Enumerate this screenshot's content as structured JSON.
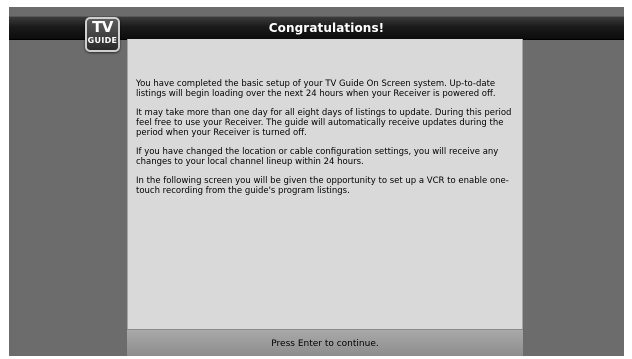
{
  "logo": {
    "line1": "TV",
    "line2": "GUIDE"
  },
  "header": {
    "title": "Congratulations!"
  },
  "content": {
    "paragraphs": [
      "You have completed the basic setup of your TV Guide On Screen system.  Up-to-date listings will begin loading over the next 24 hours when your Receiver is powered off.",
      "It may take more than one day for all eight days of listings to update.  During this period feel free to use your Receiver.  The guide will automatically receive updates during the period when your Receiver is turned off.",
      "If you have changed the location or cable configuration settings, you will receive any changes to your local channel lineup within 24 hours.",
      "In the following screen you will be given the opportunity to set up a VCR to enable one-touch recording from the guide's program listings."
    ]
  },
  "footer": {
    "prompt": "Press Enter to continue."
  },
  "colors": {
    "screen_background": "#6c6c6c",
    "panel_background": "#d9d9d9",
    "titlebar": "#141414",
    "footer": "#9a9a9a"
  }
}
